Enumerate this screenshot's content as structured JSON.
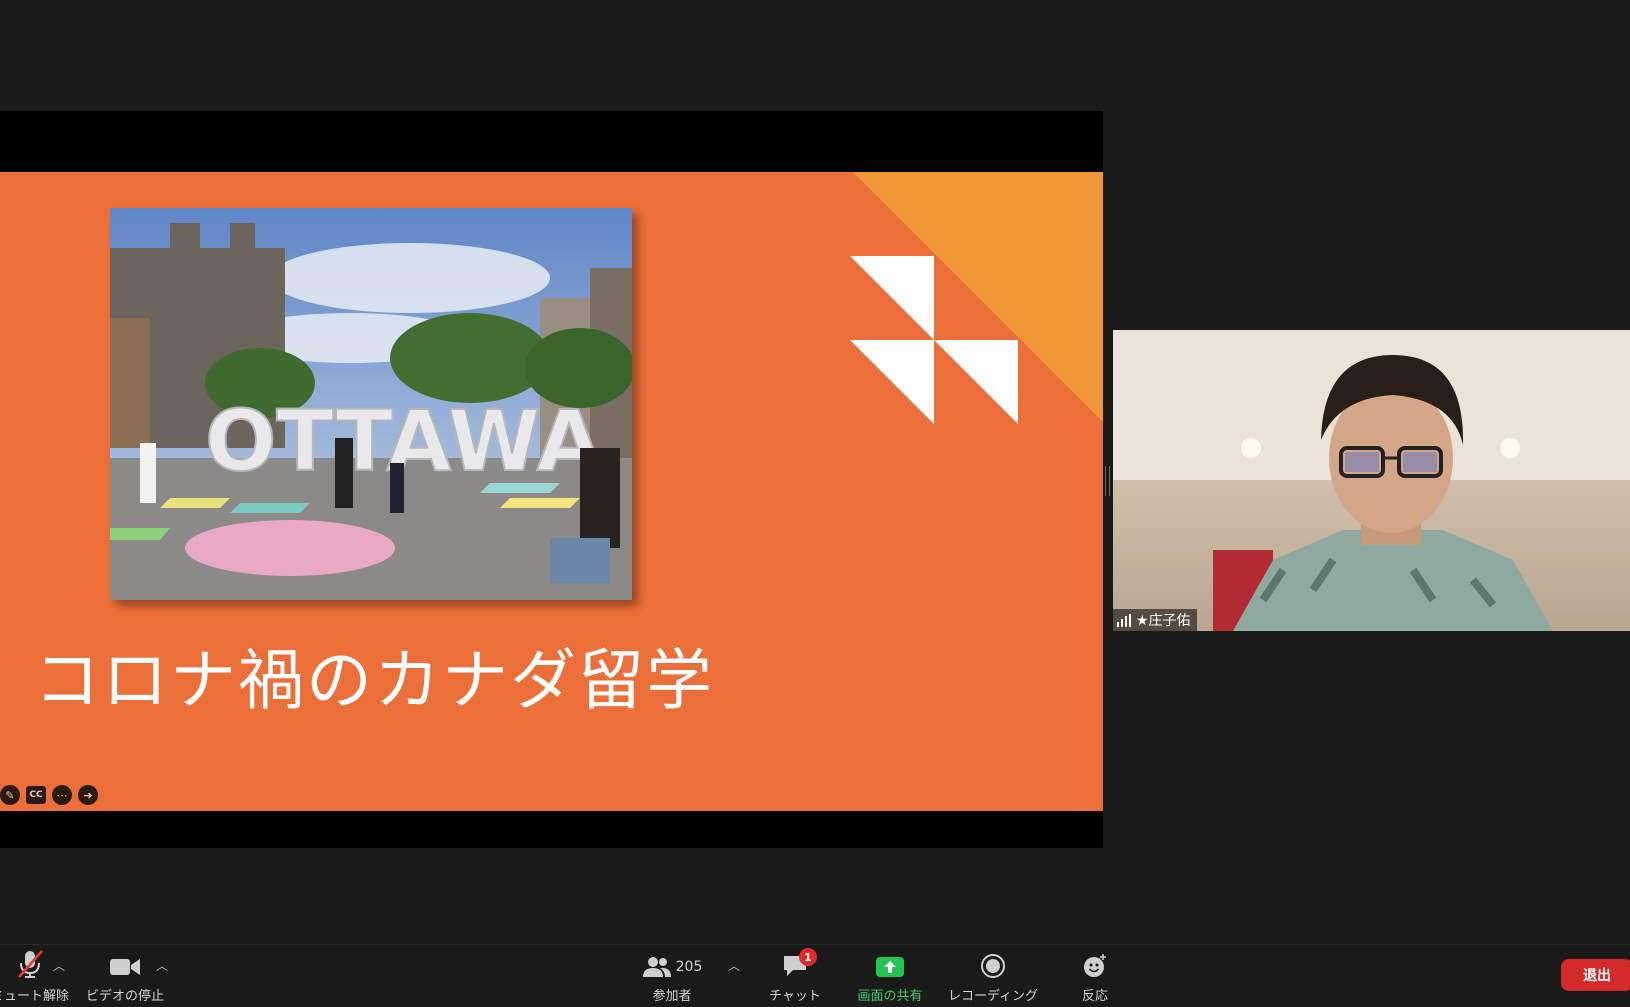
{
  "slide": {
    "title": "コロナ禍のカナダ留学",
    "photo_sign_text": "OTTAWA",
    "controls": [
      "pen-icon",
      "cc-icon",
      "more-icon",
      "next-icon"
    ],
    "cc_label": "CC",
    "colors": {
      "background": "#ec6e38",
      "accent": "#ef9636"
    }
  },
  "participant": {
    "name": "★庄子佑"
  },
  "toolbar": {
    "mute_label": "ミュート解除",
    "video_label": "ビデオの停止",
    "participants_label": "参加者",
    "participants_count": "205",
    "chat_label": "チャット",
    "chat_badge": "1",
    "share_label": "画面の共有",
    "record_label": "レコーディング",
    "reactions_label": "反応",
    "leave_label": "退出"
  }
}
